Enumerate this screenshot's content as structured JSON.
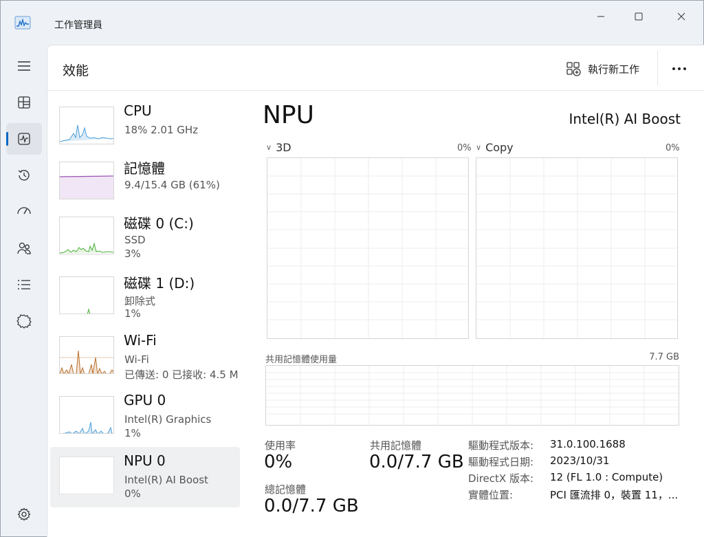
{
  "app": {
    "title": "工作管理員",
    "page_title": "效能"
  },
  "toolbar": {
    "run_new_task": "執行新工作"
  },
  "devices": [
    {
      "name": "CPU",
      "sub1": "18%  2.01 GHz",
      "sub2": ""
    },
    {
      "name": "記憶體",
      "sub1": "9.4/15.4 GB (61%)",
      "sub2": ""
    },
    {
      "name": "磁碟 0 (C:)",
      "sub1": "SSD",
      "sub2": "3%"
    },
    {
      "name": "磁碟 1 (D:)",
      "sub1": "卸除式",
      "sub2": "1%"
    },
    {
      "name": "Wi-Fi",
      "sub1": "Wi-Fi",
      "sub2": "已傳送: 0 已接收: 4.5 M"
    },
    {
      "name": "GPU 0",
      "sub1": "Intel(R) Graphics",
      "sub2": "1%"
    },
    {
      "name": "NPU 0",
      "sub1": "Intel(R) AI Boost",
      "sub2": "0%"
    }
  ],
  "selected_device_index": 6,
  "detail": {
    "title": "NPU",
    "model": "Intel(R) AI Boost",
    "graphs": [
      {
        "label": "3D",
        "percent": "0%"
      },
      {
        "label": "Copy",
        "percent": "0%"
      }
    ],
    "shared_memory_label": "共用記憶體使用量",
    "shared_memory_max": "7.7 GB",
    "stats": {
      "utilization_label": "使用率",
      "utilization_value": "0%",
      "shared_memory_label": "共用記憶體",
      "shared_memory_value": "0.0/7.7 GB",
      "total_memory_label": "總記憶體",
      "total_memory_value": "0.0/7.7 GB"
    },
    "properties": [
      {
        "label": "驅動程式版本:",
        "value": "31.0.100.1688"
      },
      {
        "label": "驅動程式日期:",
        "value": "2023/10/31"
      },
      {
        "label": "DirectX 版本:",
        "value": "12 (FL 1.0 : Compute)"
      },
      {
        "label": "實體位置:",
        "value": "PCI 匯流排 0，裝置 11，..."
      }
    ]
  },
  "colors": {
    "accent": "#0067c0",
    "cpu_line": "#4a9fd8",
    "memory_line": "#9a4fb4",
    "disk_line": "#4daf3c",
    "wifi_line": "#b86e2c",
    "gpu_line": "#4a9fd8"
  },
  "icons": {
    "nav": [
      "hamburger-menu-icon",
      "processes-icon",
      "performance-icon",
      "app-history-icon",
      "startup-apps-icon",
      "users-icon",
      "details-icon",
      "services-icon",
      "settings-icon"
    ]
  }
}
